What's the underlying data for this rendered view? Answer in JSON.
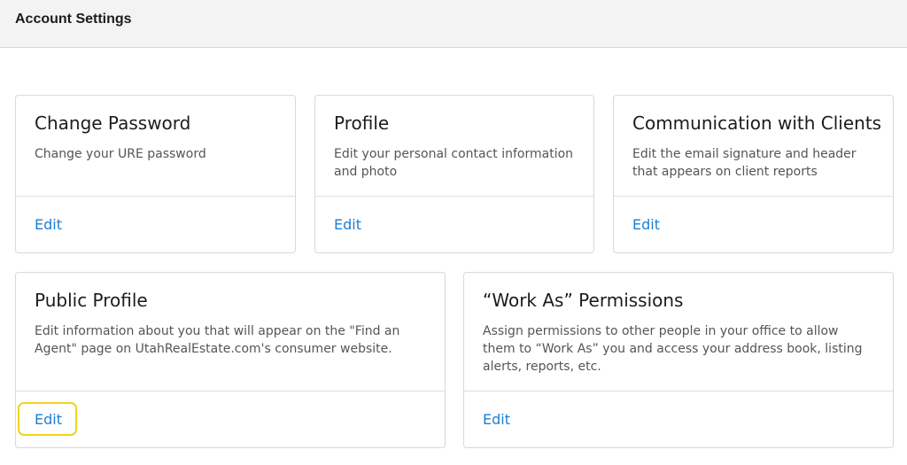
{
  "header": {
    "title": "Account Settings"
  },
  "cards": [
    {
      "title": "Change Password",
      "description": "Change your URE password",
      "action_label": "Edit"
    },
    {
      "title": "Profile",
      "description": "Edit your personal contact information and photo",
      "action_label": "Edit"
    },
    {
      "title": "Communication with Clients",
      "description": "Edit the email signature and header that appears on client reports",
      "action_label": "Edit"
    },
    {
      "title": "Public Profile",
      "description": "Edit information about you that will appear on the \"Find an Agent\" page on UtahRealEstate.com's consumer website.",
      "action_label": "Edit",
      "highlighted": true
    },
    {
      "title": "“Work As” Permissions",
      "description": "Assign permissions to other people in your office to allow them to “Work As” you and access your address book, listing alerts, reports, etc.",
      "action_label": "Edit"
    }
  ],
  "colors": {
    "link": "#1a7fd4",
    "highlight": "#f2d21d",
    "header_bg": "#f3f3f3"
  }
}
